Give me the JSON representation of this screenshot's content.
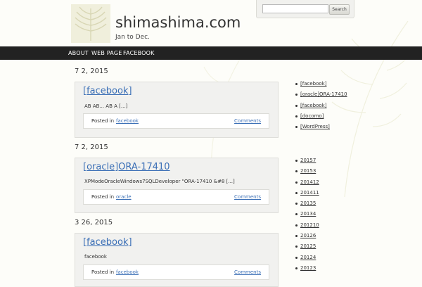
{
  "header": {
    "site_title": "shimashima.com",
    "tagline": "Jan to Dec.",
    "search": {
      "input_value": "",
      "button_label": "Search"
    }
  },
  "nav": {
    "items": [
      {
        "label": "ABOUT"
      },
      {
        "label": "WEB PAGE"
      },
      {
        "label": "FACEBOOK"
      }
    ]
  },
  "posts": [
    {
      "date": "7 2, 2015",
      "title": "[facebook]",
      "excerpt": "AB AB... AB A [...]",
      "posted_in": "Posted in",
      "category": "facebook",
      "comments": "Comments"
    },
    {
      "date": "7 2, 2015",
      "title": "[oracle]ORA-17410",
      "excerpt": "XPModeOracleWindows7SQLDeveloper \"ORA-17410 &#8 [...]",
      "posted_in": "Posted in",
      "category": "oracle",
      "comments": "Comments"
    },
    {
      "date": "3 26, 2015",
      "title": "[facebook]",
      "excerpt": "facebook",
      "posted_in": "Posted in",
      "category": "facebook",
      "comments": "Comments"
    }
  ],
  "sidebar": {
    "recent_posts": [
      "[facebook]",
      "[oracle]ORA-17410",
      "[facebook]",
      "[docomo]",
      "[WordPress]"
    ],
    "archives": [
      "20157",
      "20153",
      "201412",
      "201411",
      "20135",
      "20134",
      "201210",
      "20126",
      "20125",
      "20124",
      "20123"
    ]
  },
  "colors": {
    "nav_bg": "#222222",
    "link": "#3b6fb6",
    "post_bg": "#f1f1ef"
  }
}
